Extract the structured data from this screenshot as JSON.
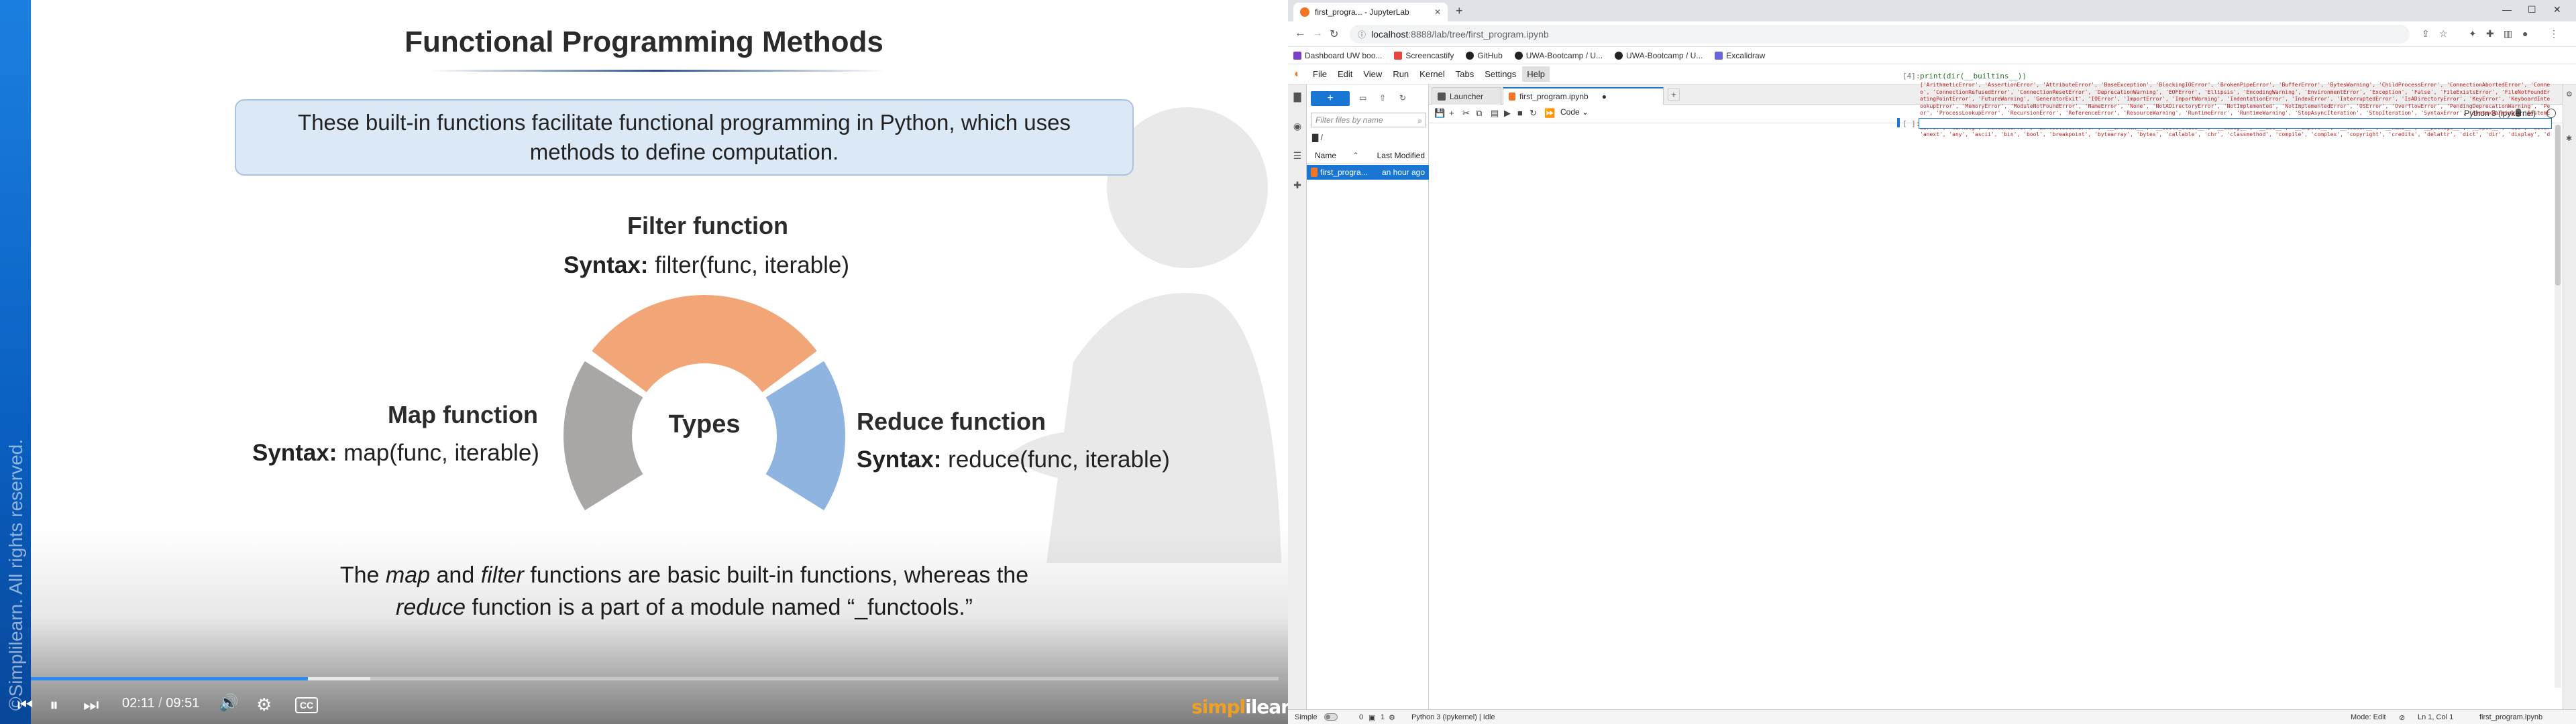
{
  "video": {
    "watermark": "©Simplilearn. All rights reserved.",
    "slide_title": "Functional Programming Methods",
    "info_text": "These built-in functions facilitate functional programming in Python, which uses methods to define computation.",
    "filter": {
      "title": "Filter function",
      "syntax_label": "Syntax:",
      "syntax_value": " filter(func, iterable)"
    },
    "map": {
      "title": "Map function",
      "syntax_label": "Syntax:",
      "syntax_value": " map(func, iterable)"
    },
    "reduce": {
      "title": "Reduce function",
      "syntax_label": "Syntax:",
      "syntax_value": " reduce(func, iterable)"
    },
    "center_label": "Types",
    "caption": {
      "p1": "The ",
      "map": "map",
      "p2": " and ",
      "filter": "filter",
      "p3": " functions are basic built-in functions, whereas the",
      "reduce": "reduce",
      "p4": " function is a part of a module named “_functools.”"
    },
    "player": {
      "current_time": "02:11",
      "separator": "/",
      "duration": "09:51",
      "progress_fraction": 0.222,
      "buffer_fraction": 0.272,
      "cc_label": "CC"
    },
    "brand_a": "simpl",
    "brand_b": "ilearn",
    "colors": {
      "filter": "#f2a577",
      "map": "#a9a6a6",
      "reduce": "#8fb4e0",
      "accent": "#2d8cf0"
    }
  },
  "browser": {
    "tab_title": "first_progra... - JupyterLab",
    "url_host": "localhost",
    "url_rest": ":8888/lab/tree/first_program.ipynb",
    "bookmarks": [
      "Dashboard UW boo...",
      "Screencastify",
      "GitHub",
      "UWA-Bootcamp / U...",
      "UWA-Bootcamp / U...",
      "Excalidraw"
    ]
  },
  "jupyter": {
    "menus": [
      "File",
      "Edit",
      "View",
      "Run",
      "Kernel",
      "Tabs",
      "Settings",
      "Help"
    ],
    "filter_placeholder": "Filter files by name",
    "path": "/",
    "col_name": "Name",
    "col_modified": "Last Modified",
    "file_name": "first_progra...",
    "file_modified": "an hour ago",
    "tabs": [
      "Launcher",
      "first_program.ipynb"
    ],
    "cell_type": "Code",
    "kernel_name": "Python 3 (ipykernel)",
    "cell1_prompt": "[4]:",
    "cell1_code": "print(dir(__builtins__))",
    "cell2_prompt": "[ ]:",
    "output": "['ArithmeticError', 'AssertionError', 'AttributeError', 'BaseException', 'BlockingIOError', 'BrokenPipeError', 'BufferError', 'BytesWarning', 'ChildProcessError', 'ConnectionAbortedError', 'ConnectionErr\no', 'ConnectionRefusedError', 'ConnectionResetError', 'DeprecationWarning', 'EOFError', 'Ellipsis', 'EncodingWarning', 'EnvironmentError', 'Exception', 'False', 'FileExistsError', 'FileNotFoundError', 'Flo\natingPointError', 'FutureWarning', 'GeneratorExit', 'IOError', 'ImportError', 'ImportWarning', 'IndentationError', 'IndexError', 'InterruptedError', 'IsADirectoryError', 'KeyError', 'KeyboardInterrupt', 'L\nookupError', 'MemoryError', 'ModuleNotFoundError', 'NameError', 'None', 'NotADirectoryError', 'NotImplemented', 'NotImplementedError', 'OSError', 'OverflowError', 'PendingDeprecationWarning', 'PermissionErr\nor', 'ProcessLookupError', 'RecursionError', 'ReferenceError', 'ResourceWarning', 'RuntimeError', 'RuntimeWarning', 'StopAsyncIteration', 'StopIteration', 'SyntaxError', 'SyntaxWarning', 'SystemError', 'S\nystemExit', 'TabError', 'TimeoutError', 'True', 'TypeError', 'UnboundLocalError', 'UnicodeDecodeError', 'UnicodeEncodeError', 'UnicodeError', 'UnicodeTranslateError', 'UnicodeWarning', 'UserWarning', 'Valu\neError', 'Warning', 'WindowsError', 'ZeroDivisionError', '__IPYTHON__', '__build_class__', '__debug__', '__doc__', '__import__', '__loader__', '__name__', '__package__', '__spec__', 'abs', 'aiter', 'all',\n'anext', 'any', 'ascii', 'bin', 'bool', 'breakpoint', 'bytearray', 'bytes', 'callable', 'chr', 'classmethod', 'compile', 'complex', 'copyright', 'credits', 'delattr', 'dict', 'dir', 'display', 'divmod', 'e\nnumerate', 'eval', 'exec', 'execfile', 'filter', 'float', 'format', 'frozenset', 'get_ipython', 'getattr', 'globals', 'hasattr', 'hash', 'help', 'hex', 'id', 'input', 'int', 'isinstance', 'issubclass', 'it\ner', 'len', 'license', 'list', 'locals', 'map', 'max', 'memoryview', 'min', 'next', 'object', 'oct', 'open', 'ord', 'pow', 'print', 'property', 'range', 'repr', 'reversed', 'round', 'runfile', 'set', 'seta\nttr', 'slice', 'sorted', 'staticmethod', 'str', 'sum', 'super', 'tuple', 'type', 'vars', 'zip']"
  },
  "statusbar": {
    "simple": "Simple",
    "count0": "0",
    "count1": "1",
    "kernel_status": "Python 3 (ipykernel) | Idle",
    "mode": "Mode: Edit",
    "position": "Ln 1, Col 1",
    "file": "first_program.ipynb"
  }
}
